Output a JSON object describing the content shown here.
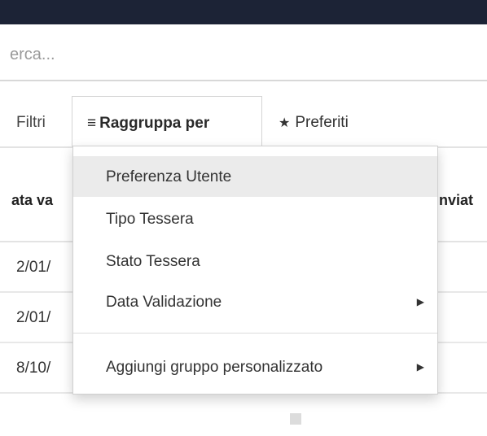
{
  "search": {
    "visible_text": "erca...",
    "placeholder": "Cerca..."
  },
  "filters": {
    "filtri_label": "Filtri",
    "group_by_icon": "≡",
    "group_by_label": "Raggruppa per",
    "favorites_icon": "★",
    "favorites_label": "Preferiti"
  },
  "table": {
    "columns": [
      "ata va",
      "inviat"
    ],
    "rows": [
      {
        "date": "2/01/"
      },
      {
        "date": "2/01/"
      },
      {
        "date": "8/10/"
      }
    ]
  },
  "group_by_menu": {
    "items": [
      {
        "label": "Preferenza Utente",
        "active": true
      },
      {
        "label": "Tipo Tessera"
      },
      {
        "label": "Stato Tessera"
      },
      {
        "label": "Data Validazione",
        "submenu_icon": "caret-right-icon"
      },
      {
        "label": "Aggiungi gruppo personalizzato",
        "submenu_icon": "caret-right-icon"
      }
    ]
  },
  "colors": {
    "topbar": "#1c2336",
    "active_item": "#ebebeb"
  }
}
